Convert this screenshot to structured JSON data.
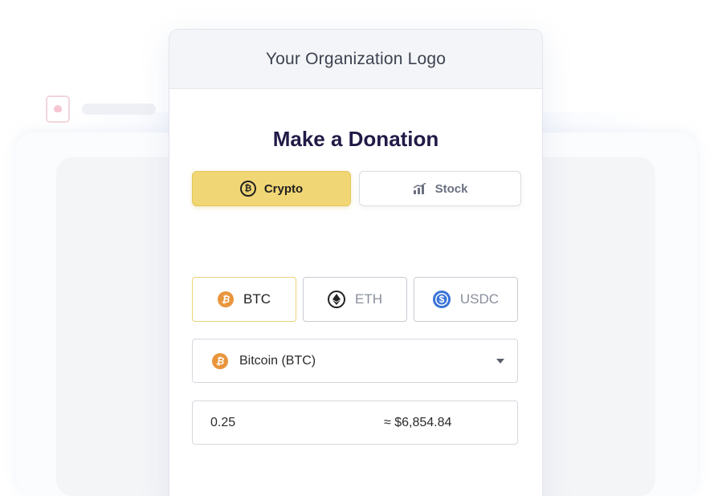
{
  "header": {
    "org_logo": "Your Organization Logo"
  },
  "title": "Make a Donation",
  "donation_types": [
    {
      "label": "Crypto",
      "icon": "bitcoin-outline-icon",
      "selected": true
    },
    {
      "label": "Stock",
      "icon": "stock-chart-icon",
      "selected": false
    }
  ],
  "coins": [
    {
      "label": "BTC",
      "icon": "bitcoin-icon",
      "selected": true
    },
    {
      "label": "ETH",
      "icon": "ethereum-icon",
      "selected": false
    },
    {
      "label": "USDC",
      "icon": "usdc-icon",
      "selected": false
    }
  ],
  "currency_select": {
    "value": "Bitcoin (BTC)",
    "icon": "bitcoin-icon"
  },
  "amount": {
    "value": "0.25",
    "usd_estimate": "≈ $6,854.84"
  },
  "colors": {
    "accent": "#f1d675",
    "btc": "#e9953d",
    "usdc": "#3a74d8",
    "title": "#221a47"
  }
}
